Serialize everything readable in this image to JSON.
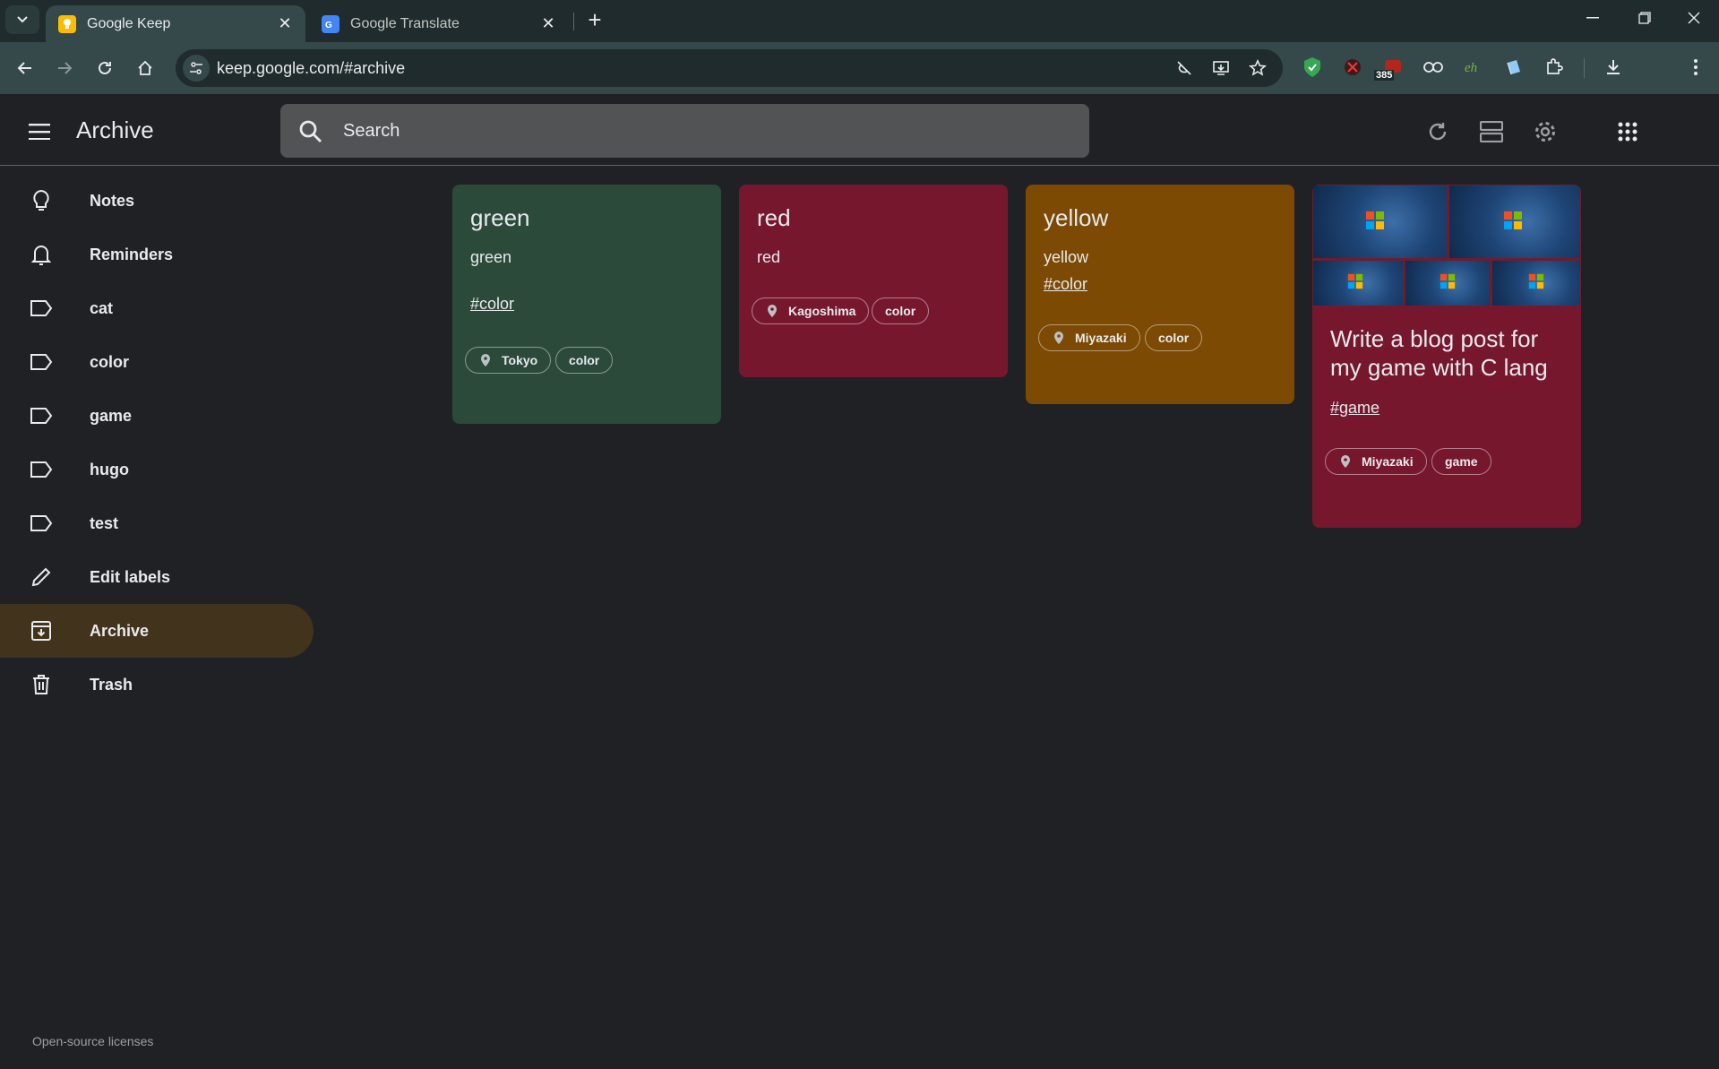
{
  "browser": {
    "tabs": [
      {
        "title": "Google Keep",
        "active": true
      },
      {
        "title": "Google Translate",
        "active": false
      }
    ],
    "url": "keep.google.com/#archive",
    "extension_badge": "385"
  },
  "header": {
    "title": "Archive",
    "search_placeholder": "Search"
  },
  "sidebar": {
    "items": [
      {
        "label": "Notes",
        "icon": "lightbulb-icon"
      },
      {
        "label": "Reminders",
        "icon": "bell-icon"
      },
      {
        "label": "cat",
        "icon": "label-icon"
      },
      {
        "label": "color",
        "icon": "label-icon"
      },
      {
        "label": "game",
        "icon": "label-icon"
      },
      {
        "label": "hugo",
        "icon": "label-icon"
      },
      {
        "label": "test",
        "icon": "label-icon"
      },
      {
        "label": "Edit labels",
        "icon": "pencil-icon"
      },
      {
        "label": "Archive",
        "icon": "archive-icon",
        "active": true
      },
      {
        "label": "Trash",
        "icon": "trash-icon"
      }
    ],
    "footer": "Open-source licenses"
  },
  "notes": [
    {
      "title": "green",
      "body": "green",
      "tag": "#color",
      "location": "Tokyo",
      "label": "color",
      "color": "#2b4a3a"
    },
    {
      "title": "red",
      "body": "red",
      "location": "Kagoshima",
      "label": "color",
      "color": "#77172e"
    },
    {
      "title": "yellow",
      "body": "yellow",
      "tag": "#color",
      "location": "Miyazaki",
      "label": "color",
      "color": "#7c4a03"
    },
    {
      "title": "Write a blog post for my game with C lang",
      "tag": "#game",
      "location": "Miyazaki",
      "label": "game",
      "color": "#77172e"
    }
  ]
}
